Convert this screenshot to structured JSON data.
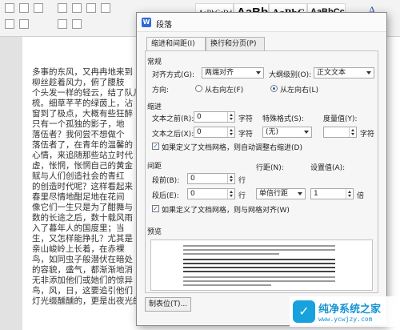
{
  "ribbon": {
    "styles": [
      "AaBbCcDd",
      "AaBb",
      "AaBbC",
      "AaBbCc"
    ],
    "letter": "A"
  },
  "document": {
    "lines": [
      "多事的东风，又冉冉地来到",
      "柳丝趁着风力，俯了腰肢",
      "个头发一样的轻云，结了队儿",
      "梳。细草芊芊的绿茵上，沾",
      "窗到了极点，大概有些狂醉",
      "只有一个孤独的影子，地",
      "落伍者？我何尝不想做个",
      "落伍者了，在青年的温馨的",
      "心情，来追随那些站立时代",
      "虚，怅惘，怅惘自己的黄金",
      "赋与人们创造社会的青红",
      "的创造时代呢？这样看起来",
      "春里尽情地酣足地在花间",
      "像它们一生只是为了酣舞与",
      "数的长途之后，数十载风雨",
      "入了暮年人的国度里；当",
      "生，又怎样能挣扎？尤其是",
      "亲山峻岭上长着，在赤裸",
      "鸟，如同虫子般潜伏在暗处",
      "的容貌，盛气，都渐渐地消",
      "无非添加他们或她们的惊异",
      "鸟，风，日，这要追引他们",
      "灯光缀醺醺的，更是出夜光的花语。在暗室的一隅，发出一声声慨"
    ]
  },
  "dialog": {
    "title": "段落",
    "tabs": [
      "缩进和间距(I)",
      "换行和分页(P)"
    ],
    "general": {
      "section": "常规",
      "align_label": "对齐方式(G):",
      "align_value": "两端对齐",
      "outline_label": "大纲级别(O):",
      "outline_value": "正文文本",
      "direction_label": "方向:",
      "dir_rtl": "从右向左(F)",
      "dir_ltr": "从左向右(L)"
    },
    "indent": {
      "section": "缩进",
      "before_label": "文本之前(R):",
      "before_value": "0",
      "after_label": "文本之后(X):",
      "after_value": "0",
      "unit": "字符",
      "special_label": "特殊格式(S):",
      "special_value": "(无)",
      "measure_label": "度量值(Y):",
      "measure_value": "",
      "grid_check": "如果定义了文档网格，则自动调整右缩进(D)"
    },
    "spacing": {
      "section": "间距",
      "before_label": "段前(B):",
      "before_value": "0",
      "after_label": "段后(E):",
      "after_value": "0",
      "unit": "行",
      "line_label": "行距(N):",
      "line_value": "单倍行距",
      "setting_label": "设置值(A):",
      "setting_value": "1",
      "setting_unit": "倍",
      "grid_check": "如果定义了文档网格，则与网格对齐(W)"
    },
    "preview": {
      "section": "预览"
    },
    "tabs_button": "制表位(T)..."
  },
  "watermark": {
    "title": "纯净系统之家",
    "url": "www.ycwjzy.com"
  }
}
